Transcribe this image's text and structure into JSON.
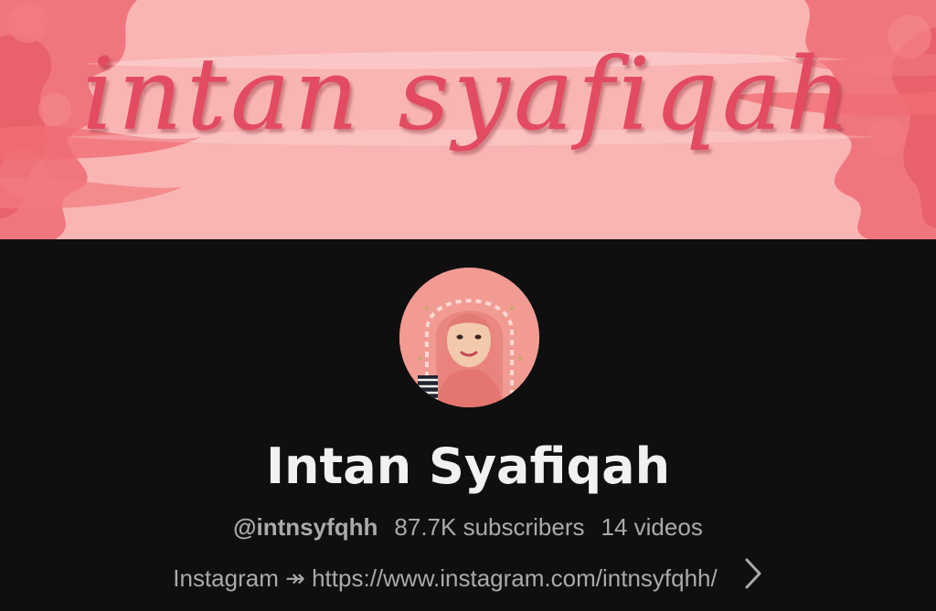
{
  "banner": {
    "title": "intan syafiqah",
    "colors": {
      "background": "#f9b5b3",
      "accent": "#e34b62",
      "paint": "#ef6b73"
    }
  },
  "channel": {
    "name": "Intan Syafiqah",
    "handle": "@intnsyfqhh",
    "subscribers": "87.7K subscribers",
    "videos": "14 videos",
    "link_text": "Instagram ↠ https://www.instagram.com/intnsyfqhh/",
    "link_icon": "chevron-right-icon"
  },
  "theme": {
    "background": "#0f0f0f",
    "primary_text": "#f1f1f1",
    "secondary_text": "#aaaaaa"
  }
}
